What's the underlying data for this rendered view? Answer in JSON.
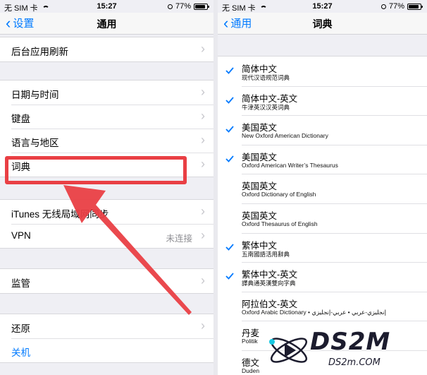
{
  "left": {
    "status": {
      "carrier": "无 SIM 卡",
      "time": "15:27",
      "battery": "77%"
    },
    "nav": {
      "back": "设置",
      "title": "通用"
    },
    "rows": {
      "background_refresh": "后台应用刷新",
      "date_time": "日期与时间",
      "keyboard": "键盘",
      "language_region": "语言与地区",
      "dictionary": "词典",
      "itunes_wifi_sync": "iTunes 无线局域网同步",
      "vpn": "VPN",
      "vpn_value": "未连接",
      "supervision": "监管",
      "reset": "还原",
      "shutdown": "关机"
    }
  },
  "right": {
    "status": {
      "carrier": "无 SIM 卡",
      "time": "15:27",
      "battery": "77%"
    },
    "nav": {
      "back": "通用",
      "title": "词典"
    },
    "dictionaries": [
      {
        "name": "简体中文",
        "sub": "现代汉语规范词典",
        "checked": true
      },
      {
        "name": "简体中文-英文",
        "sub": "牛津英汉汉英词典",
        "checked": true
      },
      {
        "name": "美国英文",
        "sub": "New Oxford American Dictionary",
        "checked": true
      },
      {
        "name": "美国英文",
        "sub": "Oxford American Writer’s Thesaurus",
        "checked": true
      },
      {
        "name": "英国英文",
        "sub": "Oxford Dictionary of English",
        "checked": false
      },
      {
        "name": "英国英文",
        "sub": "Oxford Thesaurus of English",
        "checked": false
      },
      {
        "name": "繁体中文",
        "sub": "五南國語活用辭典",
        "checked": true
      },
      {
        "name": "繁体中文-英文",
        "sub": "譯典通英漢雙向字典",
        "checked": true
      },
      {
        "name": "阿拉伯文-英文",
        "sub": "Oxford Arabic Dictionary • إنجليزي-عربي • عربي-إنجليزي",
        "checked": false
      },
      {
        "name": "丹麦",
        "sub": "Politik",
        "checked": false
      },
      {
        "name": "德文",
        "sub": "Duden",
        "checked": false
      }
    ]
  },
  "watermark": {
    "logo": "DS2M",
    "site": "DS2m.COM"
  },
  "colors": {
    "accent": "#007aff",
    "highlight": "#e93f44"
  }
}
